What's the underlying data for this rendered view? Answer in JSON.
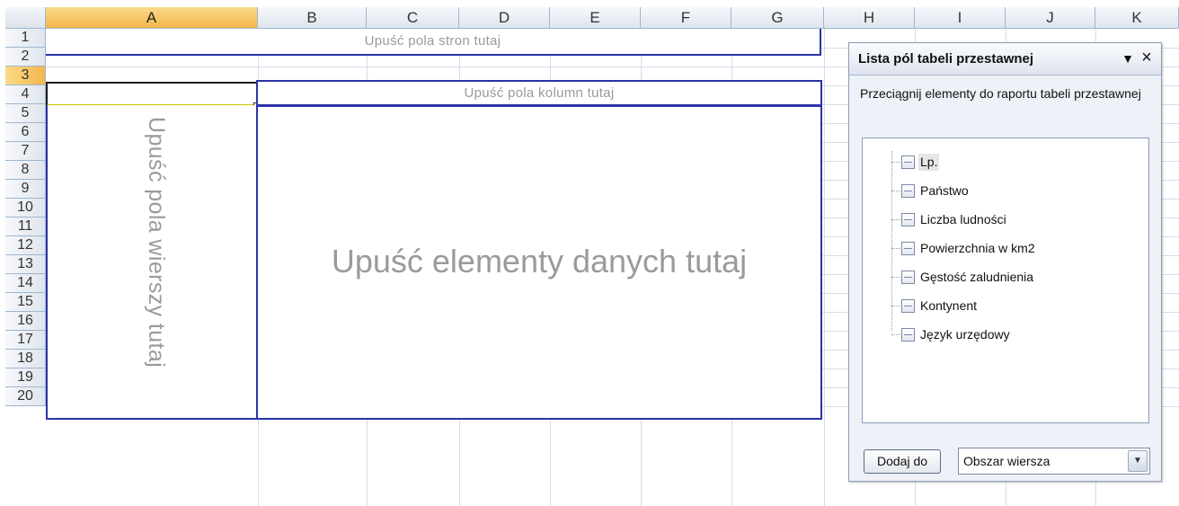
{
  "columns": [
    "A",
    "B",
    "C",
    "D",
    "E",
    "F",
    "G",
    "H",
    "I",
    "J",
    "K"
  ],
  "rows": [
    "1",
    "2",
    "3",
    "4",
    "5",
    "6",
    "7",
    "8",
    "9",
    "10",
    "11",
    "12",
    "13",
    "14",
    "15",
    "16",
    "17",
    "18",
    "19",
    "20"
  ],
  "selected_column": "A",
  "selected_row": "3",
  "pivot": {
    "page_drop_text": "Upuść pola stron tutaj",
    "column_drop_text": "Upuść pola kolumn tutaj",
    "row_drop_text": "Upuść pola wierszy tutaj",
    "data_drop_text": "Upuść elementy danych tutaj"
  },
  "field_list": {
    "title": "Lista pól tabeli przestawnej",
    "dropdown_icon": "triangle-down-icon",
    "close_icon": "close-icon",
    "instruction": "Przeciągnij elementy do raportu tabeli przestawnej",
    "fields": [
      "Lp.",
      "Państwo",
      "Liczba ludności",
      "Powierzchnia w km2",
      "Gęstość zaludnienia",
      "Kontynent",
      "Język urzędowy"
    ],
    "add_button_label": "Dodaj do",
    "area_select_value": "Obszar wiersza"
  },
  "colors": {
    "grid_line": "#d4dce8",
    "header_border": "#9eb6ce",
    "selected_header": "#f3b64a",
    "pivot_border": "#2b32a8",
    "placeholder_text": "#9a9a9a",
    "pane_background": "#eef1f7"
  }
}
